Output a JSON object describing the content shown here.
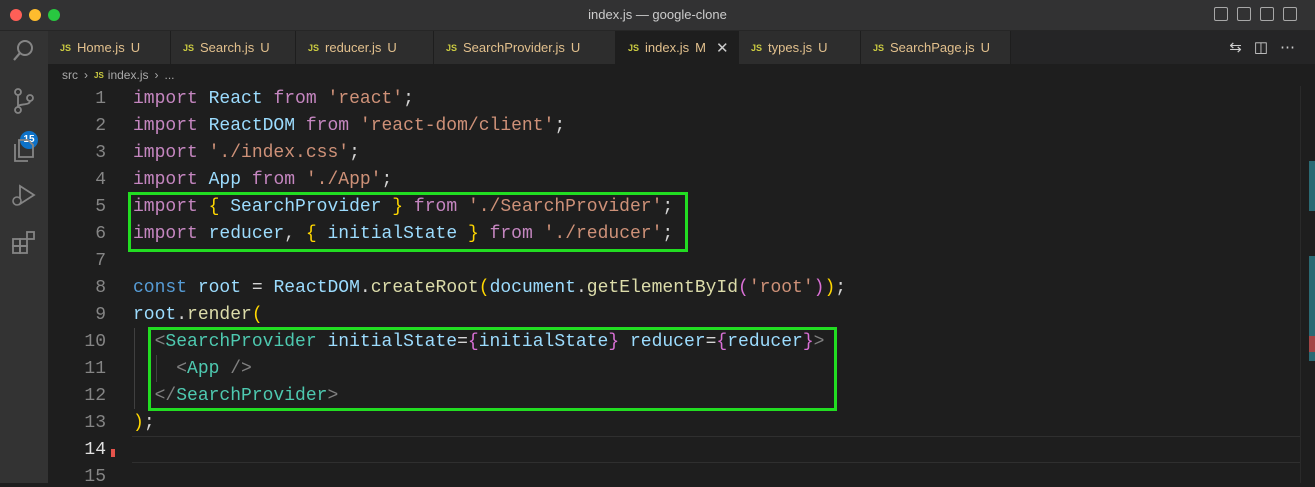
{
  "window": {
    "title": "index.js — google-clone"
  },
  "activity_bar": {
    "scm_badge": "15"
  },
  "tabs": [
    {
      "label": "Home.js",
      "status": "U",
      "active": false
    },
    {
      "label": "Search.js",
      "status": "U",
      "active": false
    },
    {
      "label": "reducer.js",
      "status": "U",
      "active": false
    },
    {
      "label": "SearchProvider.js",
      "status": "U",
      "active": false
    },
    {
      "label": "index.js",
      "status": "M",
      "active": true
    },
    {
      "label": "types.js",
      "status": "U",
      "active": false
    },
    {
      "label": "SearchPage.js",
      "status": "U",
      "active": false
    }
  ],
  "tab_file_icon": "JS",
  "breadcrumb": {
    "folder": "src",
    "file": "index.js",
    "more": "..."
  },
  "line_numbers": [
    "1",
    "2",
    "3",
    "4",
    "5",
    "6",
    "7",
    "8",
    "9",
    "10",
    "11",
    "12",
    "13",
    "14",
    "15"
  ],
  "code": {
    "l1": {
      "kw": "import",
      "name": "React",
      "from": "from",
      "str": "'react'",
      "semi": ";"
    },
    "l2": {
      "kw": "import",
      "name": "ReactDOM",
      "from": "from",
      "str": "'react-dom/client'",
      "semi": ";"
    },
    "l3": {
      "kw": "import",
      "str": "'./index.css'",
      "semi": ";"
    },
    "l4": {
      "kw": "import",
      "name": "App",
      "from": "from",
      "str": "'./App'",
      "semi": ";"
    },
    "l5": {
      "kw": "import",
      "open": "{",
      "name": "SearchProvider",
      "close": "}",
      "from": "from",
      "str": "'./SearchProvider'",
      "semi": ";"
    },
    "l6": {
      "kw": "import",
      "name": "reducer",
      "comma": ",",
      "open": "{",
      "name2": "initialState",
      "close": "}",
      "from": "from",
      "str": "'./reducer'",
      "semi": ";"
    },
    "l8": {
      "const": "const",
      "root": "root",
      "eq": "=",
      "obj": "ReactDOM",
      "dot": ".",
      "fn": "createRoot",
      "p1": "(",
      "doc": "document",
      "dot2": ".",
      "fn2": "getElementById",
      "p2": "(",
      "str": "'root'",
      "p3": ")",
      "p4": ")",
      "semi": ";"
    },
    "l9": {
      "root": "root",
      "dot": ".",
      "fn": "render",
      "paren": "("
    },
    "l10": {
      "lt": "<",
      "tag": "SearchProvider",
      "attr1": "initialState",
      "eq1": "=",
      "o1": "{",
      "v1": "initialState",
      "c1": "}",
      "attr2": "reducer",
      "eq2": "=",
      "o2": "{",
      "v2": "reducer",
      "c2": "}",
      "gt": ">"
    },
    "l11": {
      "lt": "<",
      "tag": "App",
      "end": "/>"
    },
    "l12": {
      "lt": "</",
      "tag": "SearchProvider",
      "gt": ">"
    },
    "l13": {
      "paren": ")",
      "semi": ";"
    }
  },
  "colors": {
    "highlight_box": "#22dd22",
    "keyword": "#c586c0",
    "string": "#ce9178",
    "variable": "#9cdcfe",
    "component": "#4ec9b0"
  },
  "icons": [
    "explorer-icon",
    "search-icon",
    "source-control-icon",
    "run-debug-icon",
    "extensions-icon",
    "close-icon",
    "compare-icon",
    "split-editor-icon",
    "more-icon"
  ]
}
